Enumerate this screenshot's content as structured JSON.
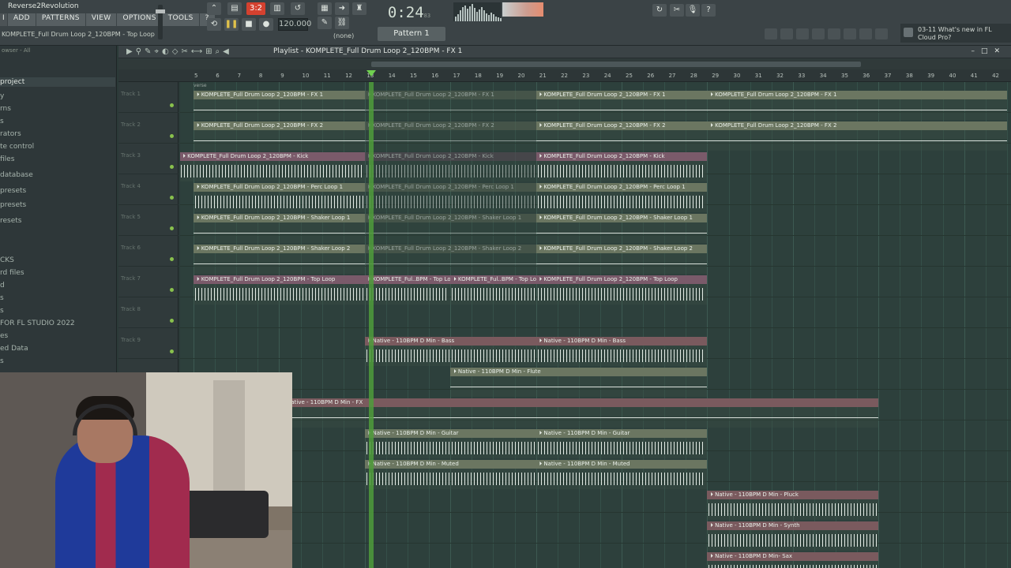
{
  "app": {
    "title": "Reverse2Revolution",
    "project_line": "KOMPLETE_Full Drum Loop 2_120BPM - Top Loop",
    "menu": [
      "I",
      "ADD",
      "PATTERNS",
      "VIEW",
      "OPTIONS",
      "TOOLS",
      "?"
    ]
  },
  "transport": {
    "pattern_mode_label": "3:2",
    "tempo": "120.000",
    "time": "0:24",
    "time_frac": "83",
    "time_sub": "M:S:CS",
    "snap": "(none)",
    "pattern": "Pattern 1"
  },
  "news": {
    "line1": "03-11  What's new in FL",
    "line2": "Cloud Pro?"
  },
  "browser": {
    "header": "owser - All",
    "items": [
      "project",
      "y",
      "rns",
      "s",
      "rators",
      "te control",
      "files",
      "database",
      "presets",
      "presets",
      "resets",
      "",
      "",
      "CKS",
      "rd files",
      "d",
      "s",
      "s",
      "FOR FL STUDIO 2022",
      "es",
      "ed Data",
      "s"
    ]
  },
  "playlist": {
    "title": "Playlist - KOMPLETE_Full Drum Loop 2_120BPM - FX 1",
    "verse_marker": "verse",
    "bars": [
      "5",
      "6",
      "7",
      "8",
      "9",
      "10",
      "11",
      "12",
      "13",
      "14",
      "15",
      "16",
      "17",
      "18",
      "19",
      "20",
      "21",
      "22",
      "23",
      "24",
      "25",
      "26",
      "27",
      "28",
      "29",
      "30",
      "31",
      "32",
      "33",
      "34",
      "35",
      "36",
      "37",
      "38",
      "39",
      "40",
      "41",
      "42"
    ],
    "tracks": [
      "Track 1",
      "Track 2",
      "Track 3",
      "Track 4",
      "Track 5",
      "Track 6",
      "Track 7",
      "Track 8",
      "Track 9"
    ]
  },
  "clips": [
    {
      "label": "KOMPLETE_Full Drum Loop 2_120BPM - FX 1",
      "track": 0,
      "bar": 1,
      "len": 8,
      "color": "#6b7661",
      "kind": "wave"
    },
    {
      "label": "KOMPLETE_Full Drum Loop 2_120BPM - FX 1",
      "track": 0,
      "bar": 9,
      "len": 8,
      "color": "#5a6655",
      "kind": "wave",
      "faded": true
    },
    {
      "label": "KOMPLETE_Full Drum Loop 2_120BPM - FX 1",
      "track": 0,
      "bar": 17,
      "len": 8,
      "color": "#6b7661",
      "kind": "wave"
    },
    {
      "label": "KOMPLETE_Full Drum Loop 2_120BPM - FX 1",
      "track": 0,
      "bar": 25,
      "len": 14,
      "color": "#6b7661",
      "kind": "wave"
    },
    {
      "label": "KOMPLETE_Full Drum Loop 2_120BPM - FX 2",
      "track": 1,
      "bar": 1,
      "len": 8,
      "color": "#6b7661",
      "kind": "wave"
    },
    {
      "label": "KOMPLETE_Full Drum Loop 2_120BPM - FX 2",
      "track": 1,
      "bar": 9,
      "len": 8,
      "color": "#5a6655",
      "kind": "wave",
      "faded": true
    },
    {
      "label": "KOMPLETE_Full Drum Loop 2_120BPM - FX 2",
      "track": 1,
      "bar": 17,
      "len": 8,
      "color": "#6b7661",
      "kind": "wave"
    },
    {
      "label": "KOMPLETE_Full Drum Loop 2_120BPM - FX 2",
      "track": 1,
      "bar": 25,
      "len": 14,
      "color": "#6b7661",
      "kind": "wave"
    },
    {
      "label": "KOMPLETE_Full Drum Loop 2_120BPM - Kick",
      "track": 2,
      "bar": 0.35,
      "len": 8.65,
      "color": "#7a5a6a",
      "kind": "bars"
    },
    {
      "label": "KOMPLETE_Full Drum Loop 2_120BPM - Kick",
      "track": 2,
      "bar": 9,
      "len": 8,
      "color": "#5c4c56",
      "kind": "bars",
      "faded": true
    },
    {
      "label": "KOMPLETE_Full Drum Loop 2_120BPM - Kick",
      "track": 2,
      "bar": 17,
      "len": 8,
      "color": "#7a5a6a",
      "kind": "bars"
    },
    {
      "label": "KOMPLETE_Full Drum Loop 2_120BPM - Perc Loop 1",
      "track": 3,
      "bar": 1,
      "len": 8,
      "color": "#6b7661",
      "kind": "bars"
    },
    {
      "label": "KOMPLETE_Full Drum Loop 2_120BPM - Perc Loop 1",
      "track": 3,
      "bar": 9,
      "len": 8,
      "color": "#5a6655",
      "kind": "bars",
      "faded": true
    },
    {
      "label": "KOMPLETE_Full Drum Loop 2_120BPM - Perc Loop 1",
      "track": 3,
      "bar": 17,
      "len": 8,
      "color": "#6b7661",
      "kind": "bars"
    },
    {
      "label": "KOMPLETE_Full Drum Loop 2_120BPM - Shaker Loop 1",
      "track": 4,
      "bar": 1,
      "len": 8,
      "color": "#6b7661",
      "kind": "wave"
    },
    {
      "label": "KOMPLETE_Full Drum Loop 2_120BPM - Shaker Loop 1",
      "track": 4,
      "bar": 9,
      "len": 8,
      "color": "#5a6655",
      "kind": "wave",
      "faded": true
    },
    {
      "label": "KOMPLETE_Full Drum Loop 2_120BPM - Shaker Loop 1",
      "track": 4,
      "bar": 17,
      "len": 8,
      "color": "#6b7661",
      "kind": "wave"
    },
    {
      "label": "KOMPLETE_Full Drum Loop 2_120BPM - Shaker Loop 2",
      "track": 5,
      "bar": 1,
      "len": 8,
      "color": "#6b7661",
      "kind": "wave"
    },
    {
      "label": "KOMPLETE_Full Drum Loop 2_120BPM - Shaker Loop 2",
      "track": 5,
      "bar": 9,
      "len": 8,
      "color": "#5a6655",
      "kind": "wave",
      "faded": true
    },
    {
      "label": "KOMPLETE_Full Drum Loop 2_120BPM - Shaker Loop 2",
      "track": 5,
      "bar": 17,
      "len": 8,
      "color": "#6b7661",
      "kind": "wave"
    },
    {
      "label": "KOMPLETE_Full Drum Loop 2_120BPM - Top Loop",
      "track": 6,
      "bar": 1,
      "len": 8,
      "color": "#7a5a6a",
      "kind": "bars"
    },
    {
      "label": "KOMPLETE_Ful..BPM - Top Loop",
      "track": 6,
      "bar": 9,
      "len": 4,
      "color": "#7a5a6a",
      "kind": "bars"
    },
    {
      "label": "KOMPLETE_Ful..BPM - Top Loop",
      "track": 6,
      "bar": 13,
      "len": 4,
      "color": "#7a5a6a",
      "kind": "bars"
    },
    {
      "label": "KOMPLETE_Full Drum Loop 2_120BPM - Top Loop",
      "track": 6,
      "bar": 17,
      "len": 8,
      "color": "#7a5a6a",
      "kind": "bars"
    },
    {
      "label": "Native - 110BPM D Min - Bass",
      "track": 8,
      "bar": 9,
      "len": 8,
      "color": "#7a5a5e",
      "kind": "bars"
    },
    {
      "label": "Native - 110BPM D Min - Bass",
      "track": 8,
      "bar": 17,
      "len": 8,
      "color": "#7a5a5e",
      "kind": "bars"
    },
    {
      "label": "Native - 110BPM D Min - Flute",
      "track": 9,
      "bar": 13,
      "len": 12,
      "color": "#6b7661",
      "kind": "wave"
    },
    {
      "label": "Native - 110BPM D Min - FX",
      "track": 10,
      "bar": 5,
      "len": 28,
      "color": "#7a5a5e",
      "kind": "wave"
    },
    {
      "label": "Native - 110BPM D Min - Guitar",
      "track": 11,
      "bar": 9,
      "len": 8,
      "color": "#6b7661",
      "kind": "bars"
    },
    {
      "label": "Native - 110BPM D Min - Guitar",
      "track": 11,
      "bar": 17,
      "len": 8,
      "color": "#6b7661",
      "kind": "bars"
    },
    {
      "label": "Native - 110BPM D Min - Muted",
      "track": 12,
      "bar": 9,
      "len": 8,
      "color": "#6b7661",
      "kind": "bars"
    },
    {
      "label": "Native - 110BPM D Min - Muted",
      "track": 12,
      "bar": 17,
      "len": 8,
      "color": "#6b7661",
      "kind": "bars"
    },
    {
      "label": "Native - 110BPM D Min - Pluck",
      "track": 13,
      "bar": 25,
      "len": 8,
      "color": "#7a5a5e",
      "kind": "bars"
    },
    {
      "label": "Native - 110BPM D Min - Synth",
      "track": 14,
      "bar": 25,
      "len": 8,
      "color": "#7a5a5e",
      "kind": "bars"
    },
    {
      "label": "Native - 110BPM D Min- Sax",
      "track": 15,
      "bar": 25,
      "len": 8,
      "color": "#7a5a5e",
      "kind": "bars"
    }
  ]
}
